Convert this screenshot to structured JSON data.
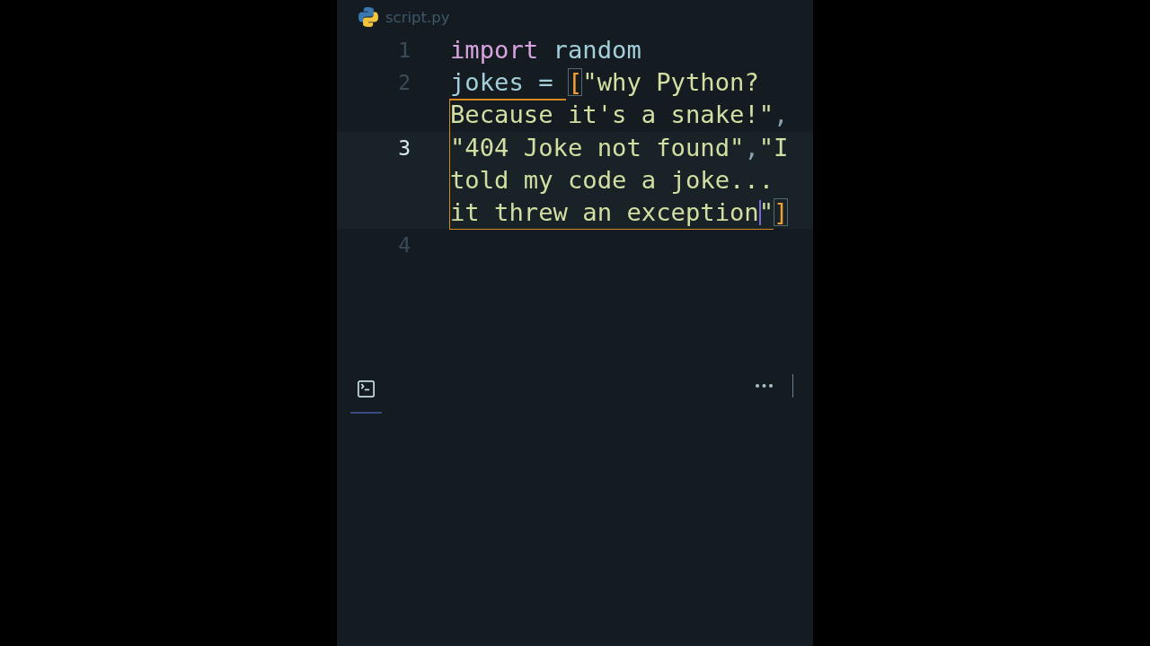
{
  "tab": {
    "label": "script.py"
  },
  "editor": {
    "lines": [
      {
        "number": "1",
        "current": false,
        "rows": [
          {
            "tokens": [
              {
                "kind": "keyword",
                "text": "import"
              },
              {
                "kind": "name",
                "text": " random"
              }
            ]
          }
        ]
      },
      {
        "number": "2",
        "current": false,
        "rows": [
          {
            "tokens": [
              {
                "kind": "name",
                "text": "jokes"
              },
              {
                "kind": "operator",
                "text": " = "
              },
              {
                "kind": "bracket",
                "text": "[",
                "matched": true
              },
              {
                "kind": "string",
                "text": "\"why Python?"
              }
            ]
          },
          {
            "tokens": [
              {
                "kind": "string",
                "text": "Because it's a snake!\""
              },
              {
                "kind": "punct",
                "text": ","
              }
            ]
          }
        ]
      },
      {
        "number": "3",
        "current": true,
        "rows": [
          {
            "tokens": [
              {
                "kind": "string",
                "text": "\"404 Joke not found\""
              },
              {
                "kind": "punct",
                "text": ","
              },
              {
                "kind": "string",
                "text": "\"I"
              }
            ]
          },
          {
            "tokens": [
              {
                "kind": "string",
                "text": "told my code a joke..."
              }
            ]
          },
          {
            "tokens": [
              {
                "kind": "string",
                "text": "it threw an exception"
              },
              {
                "kind": "string",
                "text": "\"",
                "caret": true
              },
              {
                "kind": "bracket",
                "text": "]",
                "matched": true
              }
            ]
          }
        ]
      },
      {
        "number": "4",
        "current": false
      }
    ]
  },
  "panel": {
    "tabs": [
      {
        "selected": true
      }
    ]
  }
}
